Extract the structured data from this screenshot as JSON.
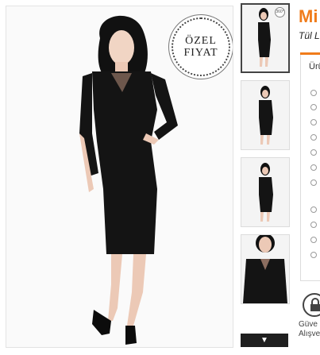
{
  "product": {
    "title": "Mi",
    "subtitle": "Tül L",
    "badge": [
      "ÖZEL",
      "FIYAT"
    ]
  },
  "thumbnails": {
    "zoom_icon_text": "360°",
    "down_arrow": "▼"
  },
  "options": {
    "header": "Ürü"
  },
  "secure": {
    "line1": "Güve",
    "line2": "Alışve"
  },
  "colors": {
    "accent": "#f07c1b",
    "dress": "#141414"
  }
}
